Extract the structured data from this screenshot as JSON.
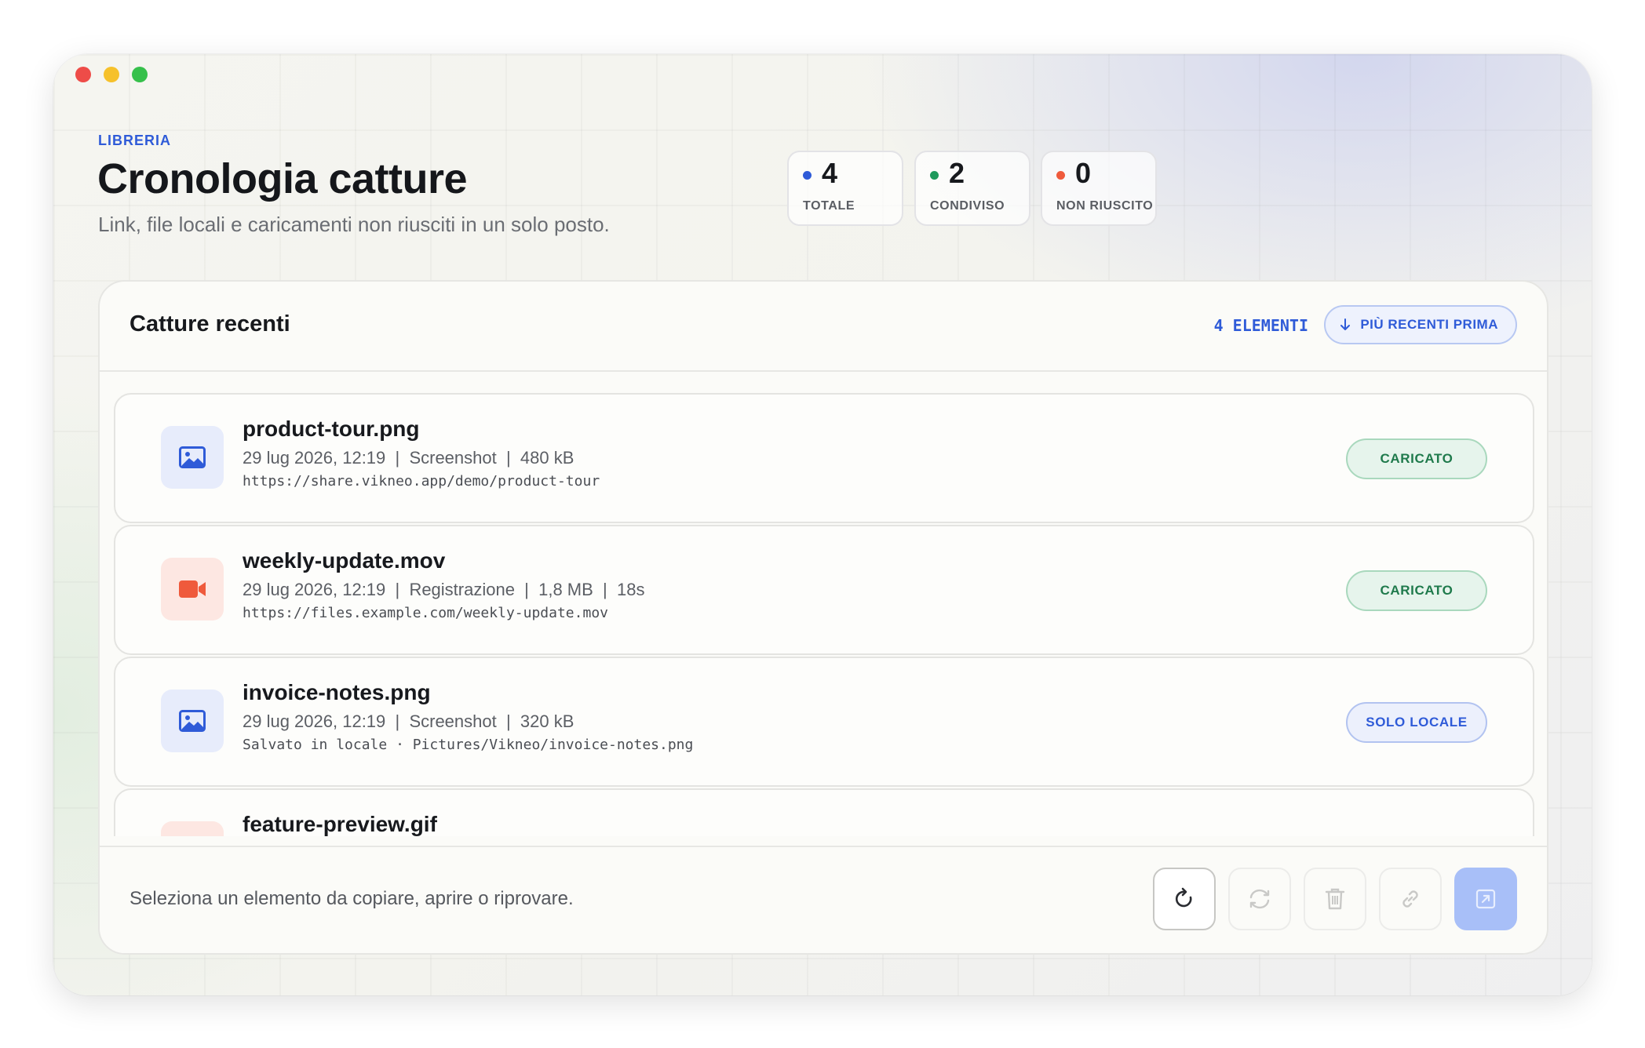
{
  "header": {
    "eyebrow": "LIBRERIA",
    "title": "Cronologia catture",
    "subtitle": "Link, file locali e caricamenti non riusciti in un solo posto."
  },
  "stats": [
    {
      "value": "4",
      "label": "TOTALE",
      "color": "#2f5bd8"
    },
    {
      "value": "2",
      "label": "CONDIVISO",
      "color": "#1f9a5c"
    },
    {
      "value": "0",
      "label": "NON RIUSCITO",
      "color": "#ef5a3c"
    }
  ],
  "panel": {
    "title": "Catture recenti",
    "count": "4 ELEMENTI",
    "sort_label": "PIÙ RECENTI PRIMA"
  },
  "items": [
    {
      "name": "product-tour.png",
      "meta": "29 lug 2026, 12:19  |  Screenshot  |  480 kB",
      "link": "https://share.vikneo.app/demo/product-tour",
      "badge": "CARICATO",
      "icon": "image-icon"
    },
    {
      "name": "weekly-update.mov",
      "meta": "29 lug 2026, 12:19  |  Registrazione  |  1,8 MB  |  18s",
      "link": "https://files.example.com/weekly-update.mov",
      "badge": "CARICATO",
      "icon": "video-camera-icon"
    },
    {
      "name": "invoice-notes.png",
      "meta": "29 lug 2026, 12:19  |  Screenshot  |  320 kB",
      "link": "Salvato in locale · Pictures/Vikneo/invoice-notes.png",
      "badge": "SOLO LOCALE",
      "icon": "image-icon"
    },
    {
      "name": "feature-preview.gif",
      "icon": "video-camera-icon"
    }
  ],
  "footer": {
    "hint": "Seleziona un elemento da copiare, aprire o riprovare."
  },
  "toolbar_icons": [
    "refresh-icon",
    "retry-icon",
    "trash-icon",
    "link-icon",
    "open-external-icon"
  ]
}
